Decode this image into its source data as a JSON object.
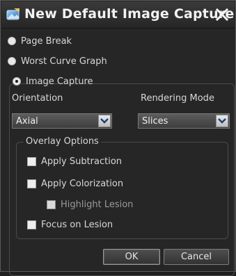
{
  "window": {
    "title": "New Default Image Capture",
    "icon": "app-capture-icon",
    "close_icon": "close-x-icon"
  },
  "options": [
    {
      "label": "Page Break",
      "selected": false
    },
    {
      "label": "Worst Curve Graph",
      "selected": false
    },
    {
      "label": "Image Capture",
      "selected": true
    }
  ],
  "orientation": {
    "label": "Orientation",
    "value": "Axial"
  },
  "rendering": {
    "label": "Rendering Mode",
    "value": "Slices"
  },
  "overlay": {
    "legend": "Overlay Options",
    "items": [
      {
        "label": "Apply Subtraction",
        "checked": false,
        "enabled": true
      },
      {
        "label": "Apply Colorization",
        "checked": false,
        "enabled": true
      },
      {
        "label": "Highlight Lesion",
        "checked": false,
        "enabled": false
      },
      {
        "label": "Focus on Lesion",
        "checked": false,
        "enabled": true
      }
    ]
  },
  "buttons": {
    "ok": "OK",
    "cancel": "Cancel"
  }
}
